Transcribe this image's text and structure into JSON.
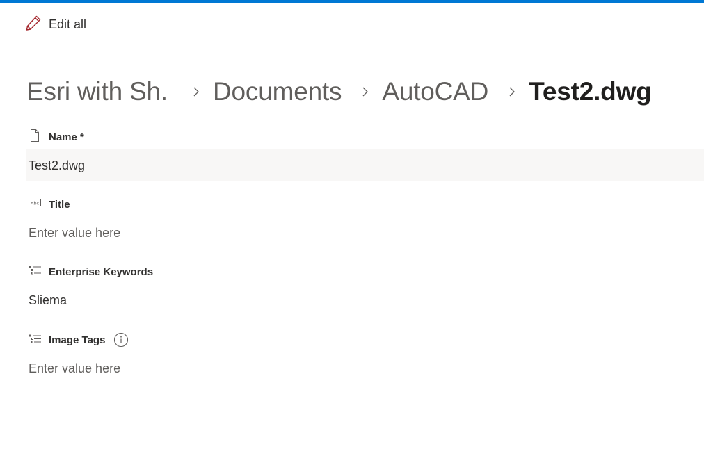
{
  "app": {
    "accent_color": "#0078d4"
  },
  "toolbar": {
    "edit_all_label": "Edit all",
    "edit_icon": "pencil-icon"
  },
  "breadcrumb": {
    "items": [
      {
        "label": "Esri with Sh..."
      },
      {
        "label": "Documents"
      },
      {
        "label": "AutoCAD"
      },
      {
        "label": "Test2.dwg"
      }
    ],
    "separator_icon": "chevron-right-icon"
  },
  "fields": {
    "name": {
      "label": "Name *",
      "icon": "document-icon",
      "value": "Test2.dwg"
    },
    "title": {
      "label": "Title",
      "icon": "text-field-icon",
      "placeholder": "Enter value here"
    },
    "enterprise_keywords": {
      "label": "Enterprise Keywords",
      "icon": "managed-metadata-icon",
      "value": "Sliema"
    },
    "image_tags": {
      "label": "Image Tags",
      "icon": "managed-metadata-icon",
      "info_icon": "info-icon",
      "placeholder": "Enter value here"
    }
  }
}
